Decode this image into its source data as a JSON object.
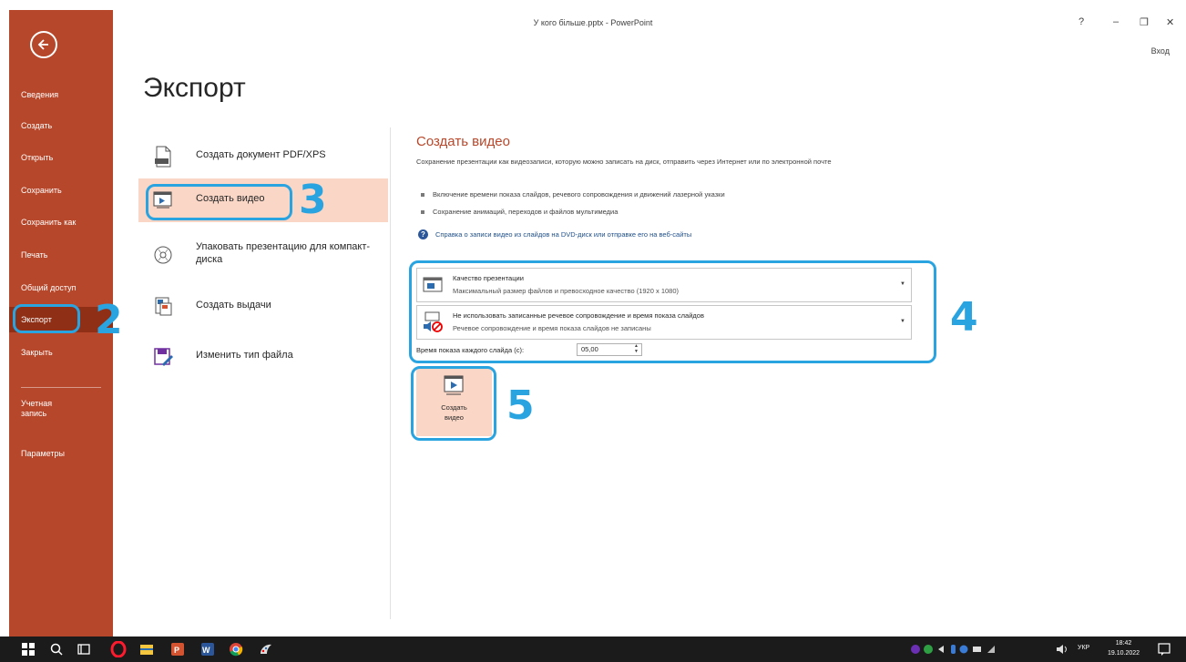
{
  "window": {
    "title": "У кого більше.pptx - PowerPoint",
    "help": "?",
    "minimize": "–",
    "restore": "❐",
    "close": "✕",
    "signin": "Вход"
  },
  "nav": {
    "items": [
      {
        "label": "Сведения"
      },
      {
        "label": "Создать"
      },
      {
        "label": "Открыть"
      },
      {
        "label": "Сохранить"
      },
      {
        "label": "Сохранить как"
      },
      {
        "label": "Печать"
      },
      {
        "label": "Общий доступ"
      },
      {
        "label": "Экспорт",
        "active": true
      },
      {
        "label": "Закрыть"
      },
      {
        "label": "Учетная запись"
      },
      {
        "label": "Параметры"
      }
    ]
  },
  "page": {
    "title": "Экспорт"
  },
  "options": [
    {
      "label": "Создать документ PDF/XPS",
      "icon": "pdf-document-icon"
    },
    {
      "label": "Создать видео",
      "icon": "video-icon",
      "selected": true
    },
    {
      "label": "Упаковать презентацию для компакт-диска",
      "icon": "cd-icon"
    },
    {
      "label": "Создать выдачи",
      "icon": "handouts-icon"
    },
    {
      "label": "Изменить тип файла",
      "icon": "file-type-icon"
    }
  ],
  "video": {
    "title": "Создать видео",
    "description": "Сохранение презентации как видеозаписи, которую можно записать на диск, отправить через Интернет или по электронной почте",
    "bullets": [
      "Включение времени показа слайдов, речевого сопровождения и движений лазерной указки",
      "Сохранение анимаций, переходов и файлов мультимедиа"
    ],
    "help_link": "Справка о записи видео из слайдов на DVD-диск или отправке его на веб-сайты",
    "quality": {
      "title": "Качество презентации",
      "subtitle": "Максимальный размер файлов и превосходное качество (1920 x 1080)"
    },
    "narration": {
      "title": "Не использовать записанные речевое сопровождение и время показа слайдов",
      "subtitle": "Речевое сопровождение и время показа слайдов не записаны"
    },
    "slide_time_label": "Время показа каждого слайда (с):",
    "slide_time_value": "05,00",
    "create_button": "Создать видео"
  },
  "annotations": [
    "2",
    "3",
    "4",
    "5"
  ],
  "taskbar": {
    "time": "18:42",
    "date": "19.10.2022",
    "lang": "УКР"
  },
  "colors": {
    "accent": "#b7472a",
    "selected": "#fad6c6",
    "annotation": "#2aa4e0",
    "taskbar": "#1b1b1b"
  }
}
